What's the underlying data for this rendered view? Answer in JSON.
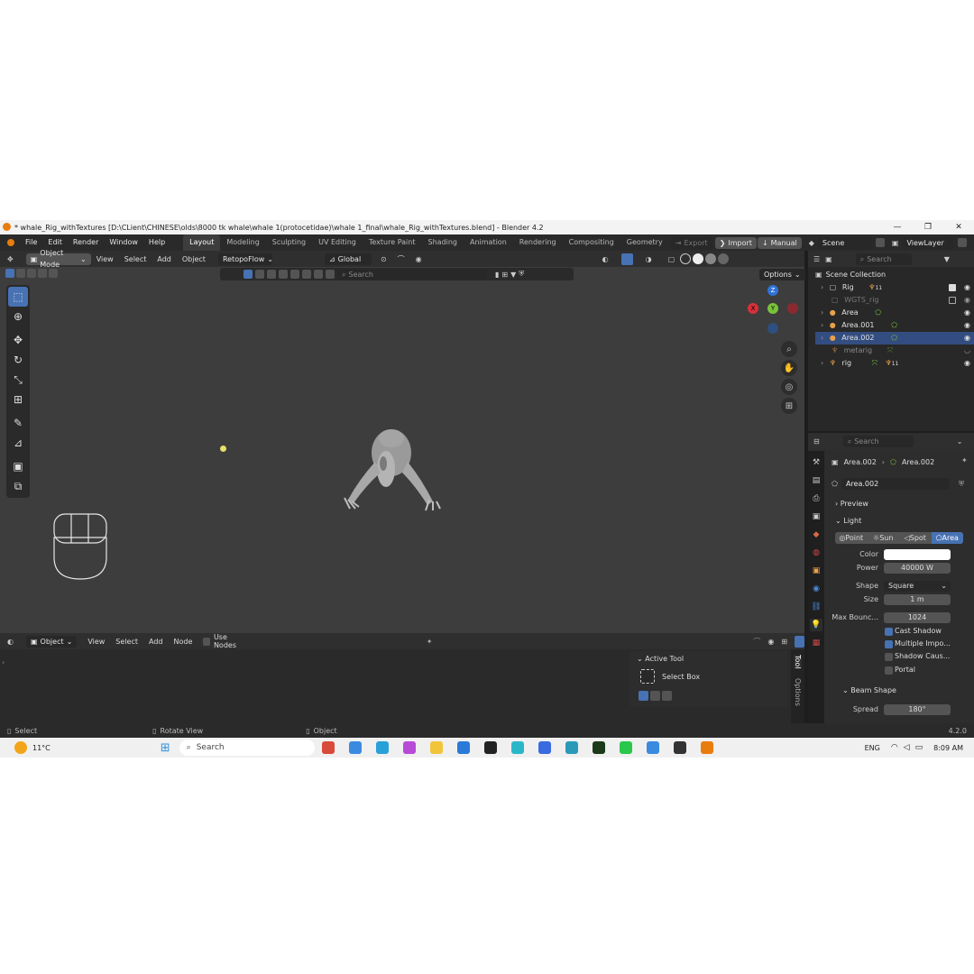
{
  "window": {
    "title": "* whale_Rig_withTextures [D:\\CLient\\CHINESE\\olds\\8000 tk whale\\whale 1(protocetidae)\\whale 1_final\\whale_Rig_withTextures.blend] - Blender 4.2",
    "controls": [
      "—",
      "❐",
      "✕"
    ]
  },
  "menubar": {
    "menus": [
      "File",
      "Edit",
      "Render",
      "Window",
      "Help"
    ],
    "workspaces": [
      "Layout",
      "Modeling",
      "Sculpting",
      "UV Editing",
      "Texture Paint",
      "Shading",
      "Animation",
      "Rendering",
      "Compositing",
      "Geometry N"
    ],
    "active_workspace": "Layout",
    "export": "Export",
    "import": "Import",
    "manual": "Manual",
    "scene": "Scene",
    "view_layer": "ViewLayer"
  },
  "viewport_header": {
    "mode": "Object Mode",
    "menus": [
      "View",
      "Select",
      "Add",
      "Object"
    ],
    "addon": "RetopoFlow",
    "transform_orientation": "Global",
    "search_placeholder": "Search",
    "options": "Options"
  },
  "gizmo": {
    "z": "Z",
    "y": "Y",
    "x": "X"
  },
  "outliner": {
    "search_placeholder": "Search",
    "root": "Scene Collection",
    "items": [
      {
        "name": "Rig",
        "badge": "11"
      },
      {
        "name": "WGTS_rig"
      },
      {
        "name": "Area"
      },
      {
        "name": "Area.001"
      },
      {
        "name": "Area.002"
      },
      {
        "name": "metarig"
      },
      {
        "name": "rig",
        "badge": "11"
      }
    ]
  },
  "properties": {
    "search_placeholder": "Search",
    "breadcrumb_object": "Area.002",
    "breadcrumb_data": "Area.002",
    "datablock": "Area.002",
    "panel_preview": "Preview",
    "panel_light": "Light",
    "light_types": [
      "Point",
      "Sun",
      "Spot",
      "Area"
    ],
    "active_light_type": "Area",
    "color_label": "Color",
    "color_value": "#ffffff",
    "power_label": "Power",
    "power_value": "40000 W",
    "shape_label": "Shape",
    "shape_value": "Square",
    "size_label": "Size",
    "size_value": "1 m",
    "max_bounces_label": "Max Bounc...",
    "max_bounces_value": "1024",
    "cast_shadow": "Cast Shadow",
    "multiple_importance": "Multiple Impo...",
    "shadow_caustics": "Shadow Caus...",
    "portal": "Portal",
    "beam_shape": "Beam Shape",
    "spread_label": "Spread",
    "spread_value": "180°"
  },
  "node_editor": {
    "type": "Object",
    "menus": [
      "View",
      "Select",
      "Add",
      "Node"
    ],
    "use_nodes": "Use Nodes"
  },
  "sidebar": {
    "active_tool_header": "Active Tool",
    "tool_name": "Select Box",
    "tabs": [
      "Tool",
      "Options"
    ]
  },
  "statusbar": {
    "select": "Select",
    "rotate_view": "Rotate View",
    "object": "Object",
    "version": "4.2.0"
  },
  "taskbar": {
    "weather": "11°C",
    "search": "Search",
    "language": "ENG",
    "time": "8:09 AM"
  },
  "colors": {
    "accent": "#4772b3",
    "viewport": "#3d3d3d",
    "panel": "#2d2d2d",
    "light_icon": "#e8a04a"
  }
}
